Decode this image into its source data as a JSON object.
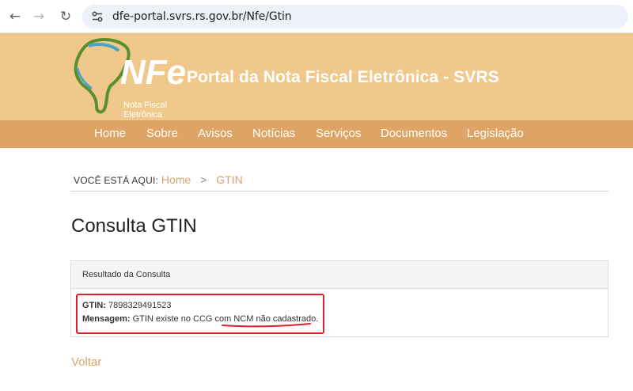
{
  "browser": {
    "url": "dfe-portal.svrs.rs.gov.br/Nfe/Gtin",
    "back_glyph": "←",
    "forward_glyph": "→",
    "reload_glyph": "↻"
  },
  "header": {
    "logo_text": "NFe",
    "logo_subtitle_line1": "Nota Fiscal",
    "logo_subtitle_line2": "Eletrônica",
    "title": "Portal da Nota Fiscal Eletrônica - SVRS"
  },
  "nav": {
    "items": [
      "Home",
      "Sobre",
      "Avisos",
      "Notícias",
      "Serviços",
      "Documentos",
      "Legislação"
    ]
  },
  "breadcrumb": {
    "prefix": "VOCÊ ESTÁ AQUI:",
    "home": "Home",
    "separator": ">",
    "current": "GTIN"
  },
  "page": {
    "title": "Consulta GTIN"
  },
  "result": {
    "heading": "Resultado da Consulta",
    "gtin_label": "GTIN:",
    "gtin_value": "7898329491523",
    "message_label": "Mensagem:",
    "message_value": "GTIN existe no CCG com NCM não cadastrado."
  },
  "back_link": "Voltar",
  "colors": {
    "header_bg": "#efc88c",
    "nav_bg": "#dea465",
    "link": "#d8a468",
    "annotation": "#e0202a"
  }
}
